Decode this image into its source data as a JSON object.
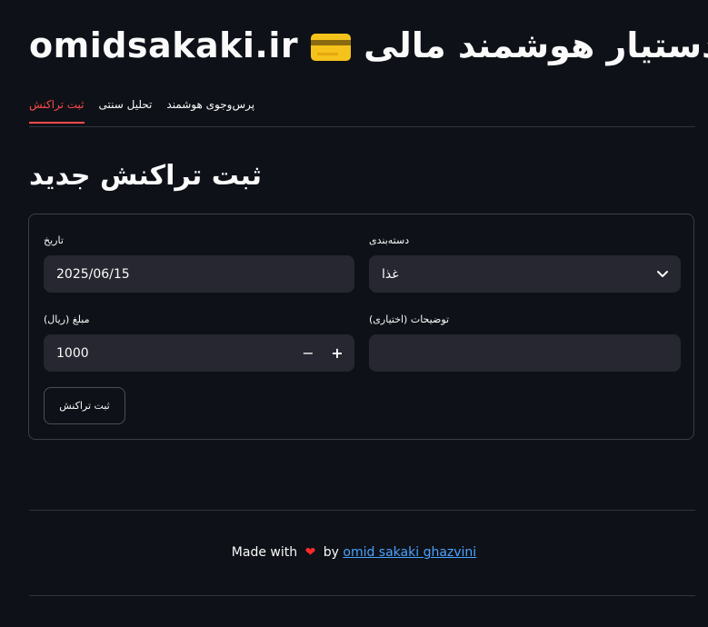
{
  "header": {
    "title_prefix": "omidsakaki.ir",
    "title_suffix": "دستیار هوشمند مالی",
    "title_icon": "credit-card-emoji"
  },
  "tabs": [
    {
      "label": "ثبت تراکنش",
      "active": true
    },
    {
      "label": "تحلیل سنتی",
      "active": false
    },
    {
      "label": "پرس‌وجوی هوشمند",
      "active": false
    }
  ],
  "form": {
    "heading": "ثبت تراکنش جدید",
    "date_label": "تاریخ",
    "date_value": "2025/06/15",
    "category_label": "دسته‌بندی",
    "category_value": "غذا",
    "amount_label": "مبلغ (ریال)",
    "amount_value": "1000",
    "description_label": "توضیحات (اختیاری)",
    "description_value": "",
    "submit_label": "ثبت تراکنش",
    "minus": "−",
    "plus": "+"
  },
  "footer": {
    "made_with": "Made with",
    "by": "by",
    "author": "omid sakaki ghazvini"
  },
  "colors": {
    "background": "#0e1117",
    "accent": "#ff4b4b",
    "input_bg": "#262730",
    "link": "#4aa3ff"
  }
}
